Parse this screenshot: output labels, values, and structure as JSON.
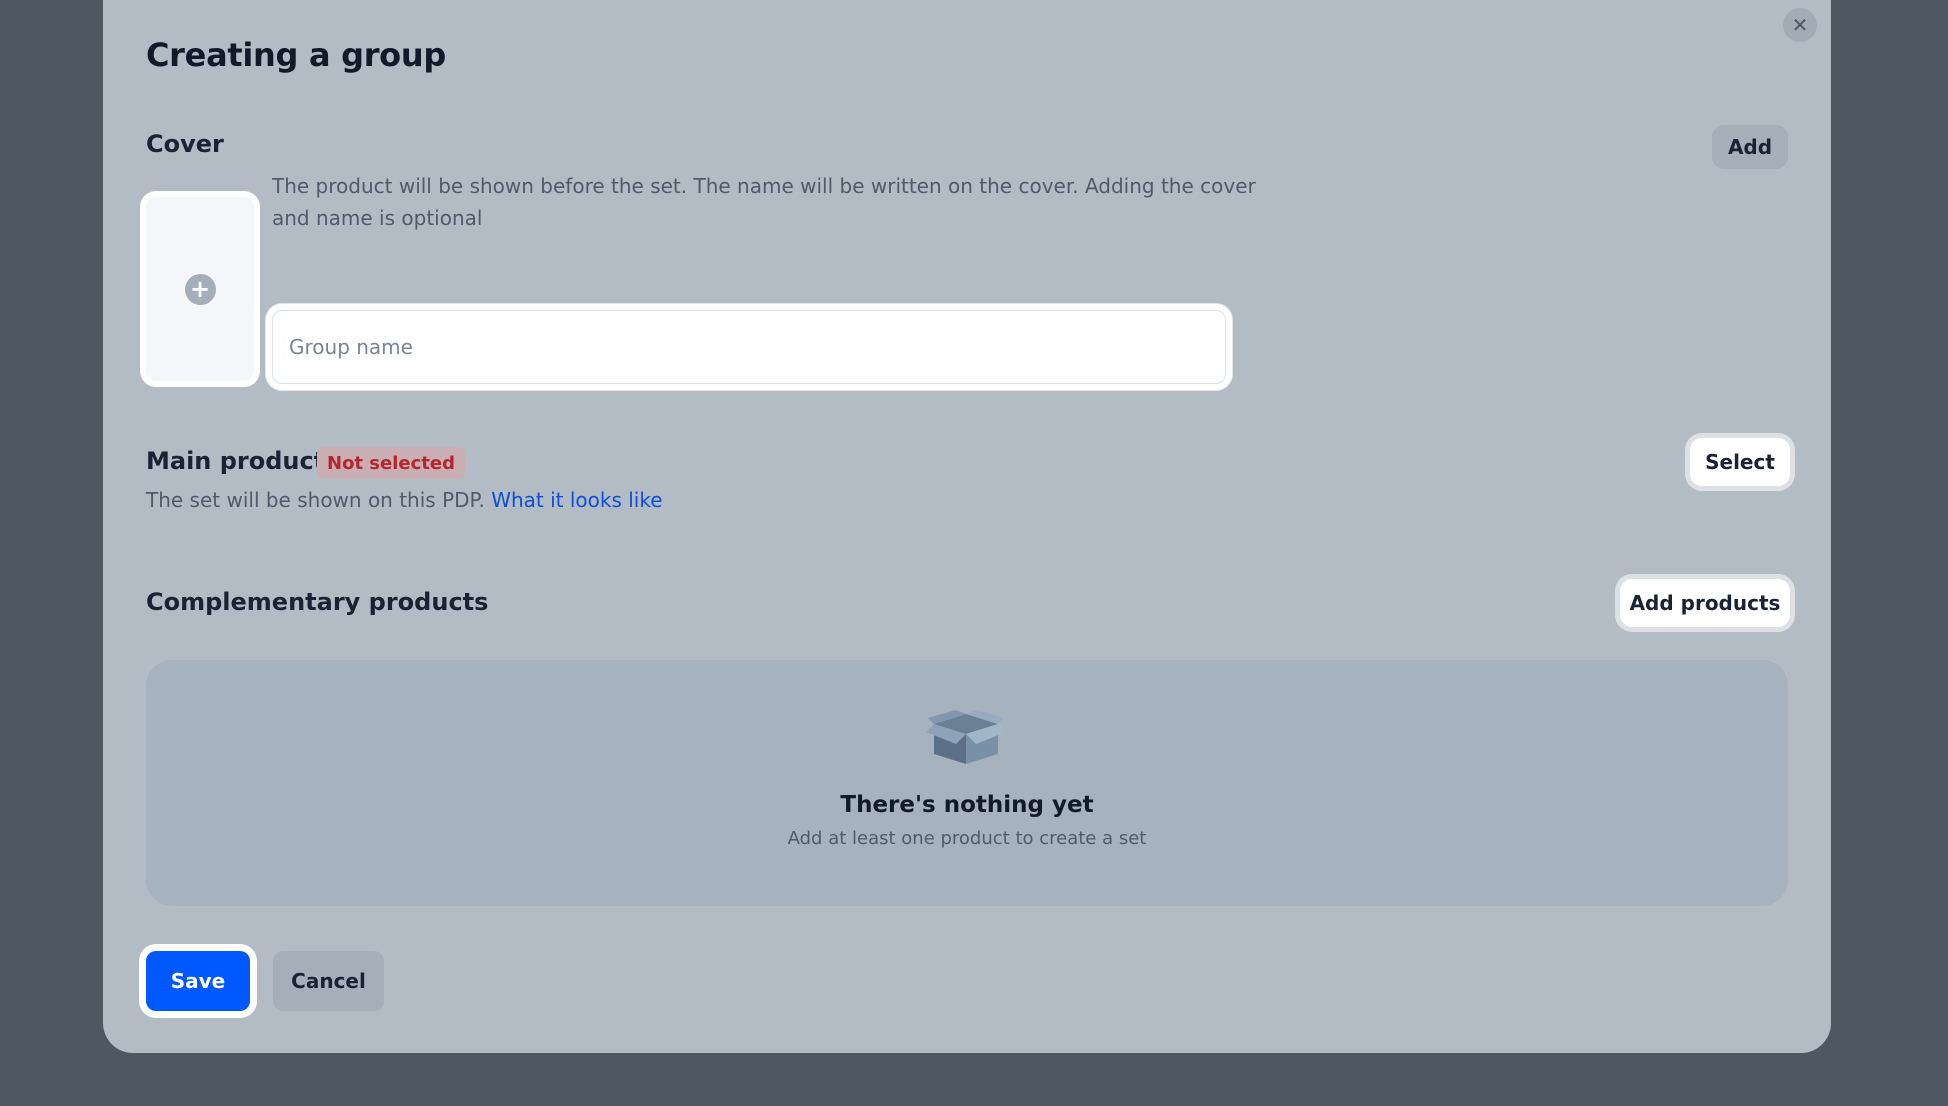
{
  "modal": {
    "title": "Creating a group",
    "close_icon": "close-icon"
  },
  "cover": {
    "title": "Cover",
    "add_label": "Add",
    "add_image_icon": "plus-icon",
    "description": "The product will be shown before the set. The name will be written on the cover. Adding the cover and name is optional",
    "name_placeholder": "Group name",
    "name_value": ""
  },
  "main_product": {
    "title": "Main product",
    "badge": "Not selected",
    "description": "The set will be shown on this PDP.",
    "link_label": "What it looks like",
    "select_label": "Select"
  },
  "complementary": {
    "title": "Complementary products",
    "add_label": "Add products",
    "empty_icon": "box-icon",
    "empty_title": "There's nothing yet",
    "empty_subtitle": "Add at least one product to create a set"
  },
  "footer": {
    "save_label": "Save",
    "cancel_label": "Cancel"
  },
  "colors": {
    "primary": "#0058ff",
    "badge_text": "#b3262e",
    "link": "#0d4fd8"
  }
}
